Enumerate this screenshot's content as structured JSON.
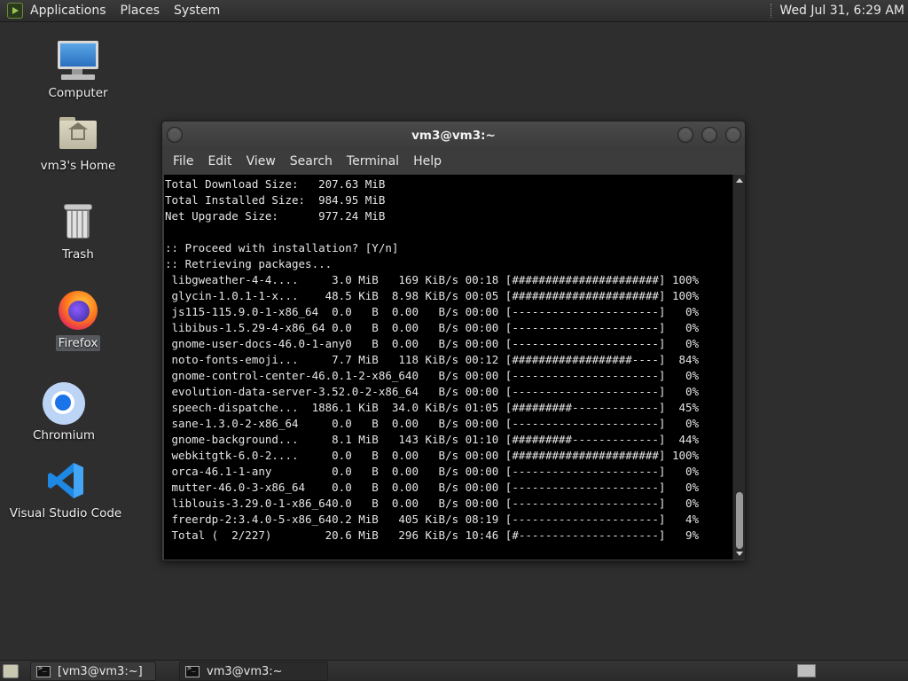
{
  "top_panel": {
    "menus": [
      "Applications",
      "Places",
      "System"
    ],
    "clock": "Wed Jul 31,  6:29 AM"
  },
  "desktop_icons": [
    {
      "label": "Computer",
      "icon": "computer-icon"
    },
    {
      "label": "vm3's Home",
      "icon": "home-folder-icon"
    },
    {
      "label": "Trash",
      "icon": "trash-icon"
    },
    {
      "label": "Firefox",
      "icon": "firefox-icon"
    },
    {
      "label": "Chromium",
      "icon": "chromium-icon"
    },
    {
      "label": "Visual Studio Code",
      "icon": "vscode-icon"
    }
  ],
  "terminal": {
    "title": "vm3@vm3:~",
    "menus": [
      "File",
      "Edit",
      "View",
      "Search",
      "Terminal",
      "Help"
    ],
    "lines": [
      "Total Download Size:   207.63 MiB",
      "Total Installed Size:  984.95 MiB",
      "Net Upgrade Size:      977.24 MiB",
      "",
      ":: Proceed with installation? [Y/n]",
      ":: Retrieving packages...",
      " libgweather-4-4....     3.0 MiB   169 KiB/s 00:18 [######################] 100%",
      " glycin-1.0.1-1-x...    48.5 KiB  8.98 KiB/s 00:05 [######################] 100%",
      " js115-115.9.0-1-x86_64  0.0   B  0.00   B/s 00:00 [----------------------]   0%",
      " libibus-1.5.29-4-x86_64 0.0   B  0.00   B/s 00:00 [----------------------]   0%",
      " gnome-user-docs-46.0-1-any0   B  0.00   B/s 00:00 [----------------------]   0%",
      " noto-fonts-emoji...     7.7 MiB   118 KiB/s 00:12 [##################----]  84%",
      " gnome-control-center-46.0.1-2-x86_640   B/s 00:00 [----------------------]   0%",
      " evolution-data-server-3.52.0-2-x86_64   B/s 00:00 [----------------------]   0%",
      " speech-dispatche...  1886.1 KiB  34.0 KiB/s 01:05 [#########-------------]  45%",
      " sane-1.3.0-2-x86_64     0.0   B  0.00   B/s 00:00 [----------------------]   0%",
      " gnome-background...     8.1 MiB   143 KiB/s 01:10 [#########-------------]  44%",
      " webkitgtk-6.0-2....     0.0   B  0.00   B/s 00:00 [######################] 100%",
      " orca-46.1-1-any         0.0   B  0.00   B/s 00:00 [----------------------]   0%",
      " mutter-46.0-3-x86_64    0.0   B  0.00   B/s 00:00 [----------------------]   0%",
      " liblouis-3.29.0-1-x86_640.0   B  0.00   B/s 00:00 [----------------------]   0%",
      " freerdp-2:3.4.0-5-x86_640.2 MiB   405 KiB/s 08:19 [----------------------]   4%",
      " Total (  2/227)        20.6 MiB   296 KiB/s 10:46 [#---------------------]   9%"
    ]
  },
  "taskbar": {
    "tasks": [
      {
        "label": "[vm3@vm3:~]",
        "active": false
      },
      {
        "label": "vm3@vm3:~",
        "active": true
      }
    ]
  }
}
